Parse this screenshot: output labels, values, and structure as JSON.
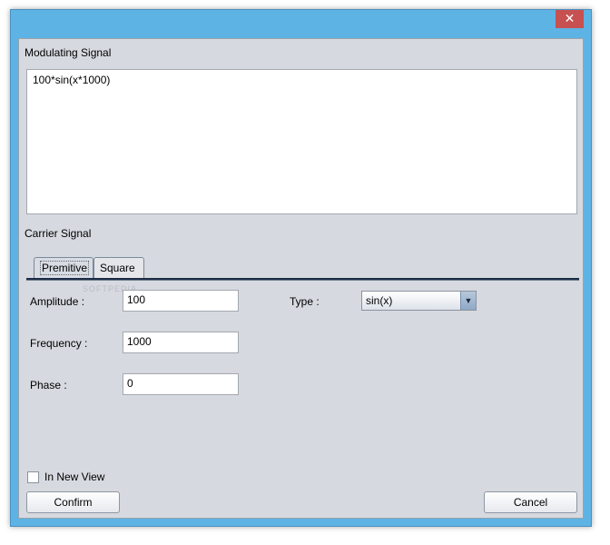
{
  "window": {
    "close_label": "✕"
  },
  "modulating": {
    "label": "Modulating Signal",
    "value": "100*sin(x*1000)"
  },
  "carrier": {
    "label": "Carrier Signal",
    "tabs": [
      {
        "label": "Premitive",
        "active": true
      },
      {
        "label": "Square",
        "active": false
      }
    ],
    "amplitude_label": "Amplitude :",
    "amplitude_value": "100",
    "frequency_label": "Frequency :",
    "frequency_value": "1000",
    "phase_label": "Phase :",
    "phase_value": "0",
    "type_label": "Type :",
    "type_value": "sin(x)"
  },
  "options": {
    "new_view_label": "In New View",
    "new_view_checked": false
  },
  "buttons": {
    "confirm": "Confirm",
    "cancel": "Cancel"
  },
  "watermark": "SOFTPEDIA"
}
